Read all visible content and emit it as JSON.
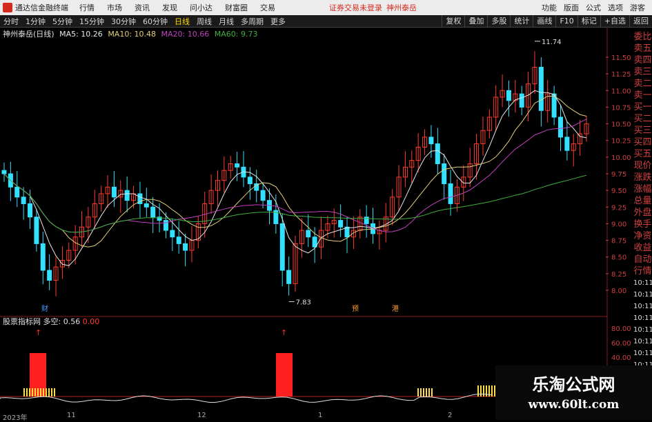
{
  "titlebar": {
    "app_name": "通达信金融终端",
    "menus": [
      "行情",
      "市场",
      "资讯",
      "发现",
      "问小达",
      "财富圈",
      "交易"
    ],
    "login_status": "证券交易未登录",
    "stock_link": "神州泰岳",
    "right_items": [
      "功能",
      "版面",
      "公式",
      "选项",
      "游客"
    ]
  },
  "toolbar": {
    "periods": [
      "分时",
      "1分钟",
      "5分钟",
      "15分钟",
      "30分钟",
      "60分钟",
      "日线",
      "周线",
      "月线",
      "多周期",
      "更多"
    ],
    "active_period": "日线",
    "right_buttons": [
      "复权",
      "叠加",
      "多股",
      "统计",
      "画线",
      "F10",
      "标记",
      "+自选",
      "返回"
    ]
  },
  "legend": {
    "stock": "神州泰岳(日线)",
    "ma5": "MA5: 10.26",
    "ma10": "MA10: 10.48",
    "ma20": "MA20: 10.66",
    "ma60": "MA60: 9.73"
  },
  "colors": {
    "up": "#ff3b30",
    "down": "#33e0ff",
    "ma5": "#e8e8e8",
    "ma10": "#e6d078",
    "ma20": "#c040c0",
    "ma60": "#40b040",
    "axis": "#d04040"
  },
  "price_axis": [
    "11.50",
    "11.25",
    "11.00",
    "10.75",
    "10.50",
    "10.25",
    "10.00",
    "9.75",
    "9.50",
    "9.25",
    "9.00",
    "8.75",
    "8.50",
    "8.25",
    "8.00"
  ],
  "annotations": {
    "high": "11.74",
    "low": "7.83",
    "markers": [
      "财",
      "预",
      "港"
    ]
  },
  "sidebar_labels": [
    "委比",
    "卖五",
    "卖四",
    "卖三",
    "卖二",
    "卖一",
    "买一",
    "买二",
    "买三",
    "买四",
    "买五",
    "现价",
    "涨跌",
    "涨幅",
    "总量",
    "外盘",
    "换手",
    "净资",
    "收益",
    "自动",
    "行情",
    "10:11",
    "10:11",
    "10:11",
    "10:11",
    "10:11",
    "10:11",
    "10:11",
    "10:11"
  ],
  "indicator": {
    "name": "股票指标网",
    "label": "多空: 0.56",
    "value2": "0.00",
    "axis": [
      "80.00",
      "60.00",
      "40.00"
    ]
  },
  "date_axis": [
    "2023年",
    "11",
    "12",
    "1",
    "2"
  ],
  "watermark": {
    "line1": "乐淘公式网",
    "line2": "www.60lt.com"
  }
}
